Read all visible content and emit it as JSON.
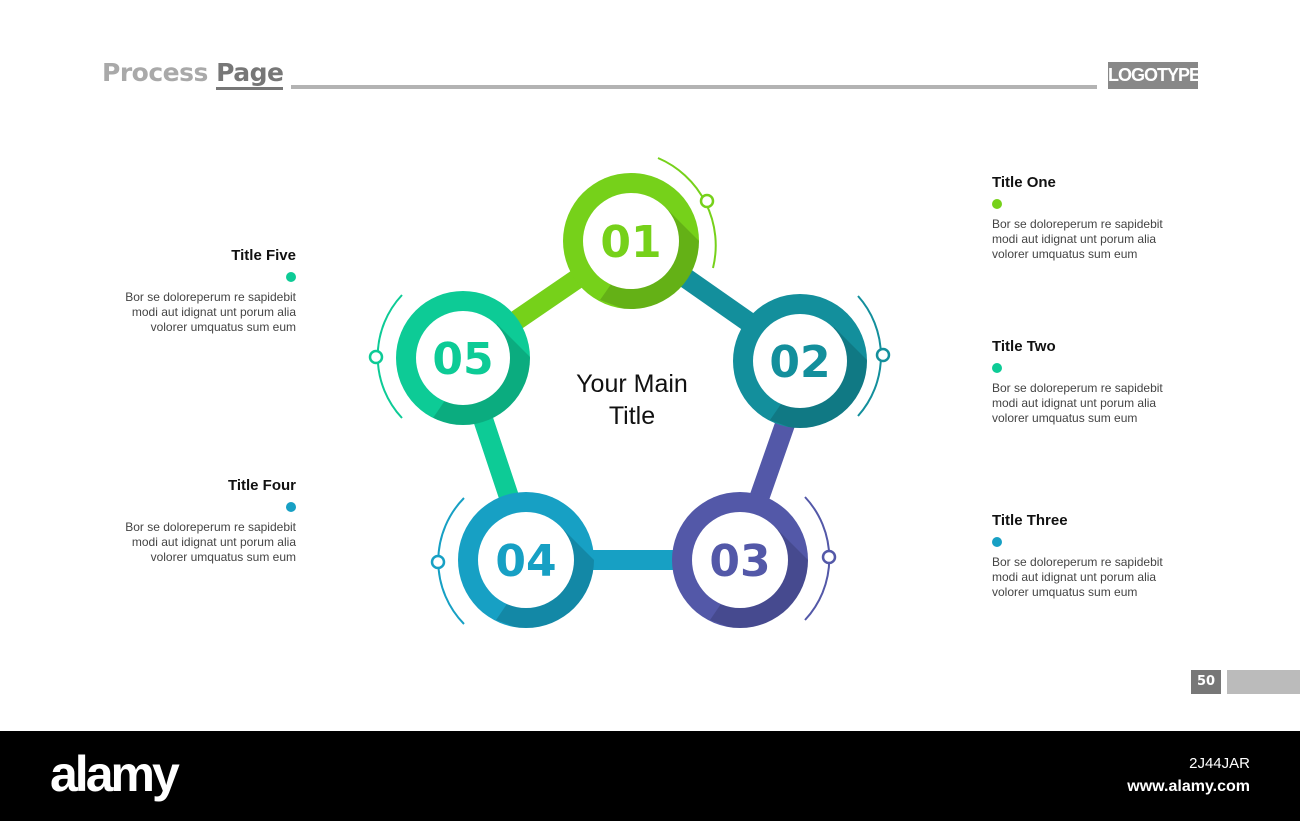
{
  "header": {
    "title_part1": "Process",
    "title_part2": "Page",
    "logo": "LOGOTYPE"
  },
  "center_title": "Your Main Title",
  "colors": {
    "step1": "#76d11a",
    "step2": "#138f9c",
    "step3": "#5358a8",
    "step4": "#17a0c4",
    "step5": "#0dcb96"
  },
  "steps": [
    {
      "number": "01",
      "title": "Title One",
      "text": "Bor se doloreperum re sapidebit modi aut idignat unt porum alia volorer umquatus sum eum"
    },
    {
      "number": "02",
      "title": "Title Two",
      "text": "Bor se doloreperum re sapidebit modi aut idignat unt porum alia volorer umquatus sum eum"
    },
    {
      "number": "03",
      "title": "Title Three",
      "text": "Bor se doloreperum re sapidebit modi aut idignat unt porum alia volorer umquatus sum eum"
    },
    {
      "number": "04",
      "title": "Title Four",
      "text": "Bor se doloreperum re sapidebit modi aut idignat unt porum alia volorer umquatus sum eum"
    },
    {
      "number": "05",
      "title": "Title Five",
      "text": "Bor se doloreperum re sapidebit modi aut idignat unt porum alia volorer umquatus sum eum"
    }
  ],
  "page_number": "50",
  "watermark": {
    "brand": "alamy",
    "image_id": "2J44JAR",
    "url": "www.alamy.com"
  }
}
